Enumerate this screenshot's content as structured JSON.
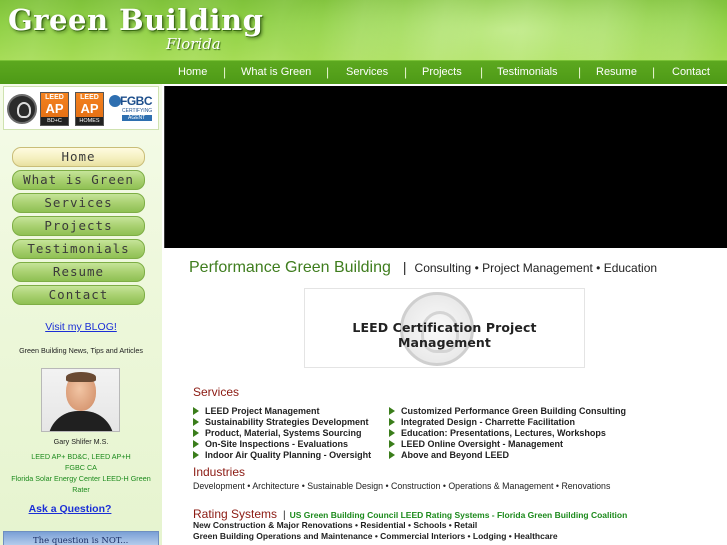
{
  "header": {
    "title": "Green Building",
    "subtitle": "Florida"
  },
  "topnav": {
    "items": [
      "Home",
      "What is Green",
      "Services",
      "Projects",
      "Testimonials",
      "Resume",
      "Contact"
    ],
    "separator": "|"
  },
  "sidebar": {
    "certs": {
      "leed_bdc": {
        "top": "LEED",
        "mid": "AP",
        "bottom": "BD+C"
      },
      "leed_homes": {
        "top": "LEED",
        "mid": "AP",
        "bottom": "HOMES"
      },
      "fgbc": {
        "name": "FGBC",
        "sub": "CERTIFYING",
        "agent": "AGENT"
      }
    },
    "buttons": [
      "Home",
      "What is Green",
      "Services",
      "Projects",
      "Testimonials",
      "Resume",
      "Contact"
    ],
    "blog_link": "Visit my BLOG!",
    "blog_sub": "Green Building News, Tips and Articles",
    "person_name": "Gary Shlifer M.S.",
    "credentials": [
      "LEED AP+ BD&C, LEED AP+H",
      "FGBC CA",
      "Florida Solar Energy Center LEED-H Green Rater"
    ],
    "ask_link": "Ask a Question?",
    "question_box": "The question is NOT..."
  },
  "main": {
    "heading": "Performance Green Building",
    "heading_sep": "|",
    "heading_sub": "Consulting • Project Management • Education",
    "banner_text": "LEED Certification Project Management",
    "services_title": "Services",
    "services_left": [
      "LEED Project Management",
      "Sustainability Strategies Development",
      "Product, Material, Systems Sourcing",
      "On-Site Inspections - Evaluations",
      "Indoor Air Quality Planning - Oversight"
    ],
    "services_right": [
      "Customized Performance Green Building Consulting",
      "Integrated Design - Charrette Facilitation",
      "Education: Presentations, Lectures, Workshops",
      "LEED Online Oversight - Management",
      "Above and Beyond LEED"
    ],
    "industries_title": "Industries",
    "industries_text": "Development • Architecture • Sustainable Design • Construction • Operations & Management • Renovations",
    "rating_title": "Rating Systems",
    "rating_sep": "|",
    "rating_sub": "US Green Building Council LEED Rating Systems - Florida Green Building Coalition",
    "rating_line1": "New Construction & Major Renovations • Residential • Schools • Retail",
    "rating_line2": "Green Building Operations and Maintenance • Commercial Interiors • Lodging • Healthcare"
  },
  "colors": {
    "brand_green": "#4e9a17",
    "heading_green": "#3f7d1e",
    "section_red": "#8b1a12",
    "link_blue": "#1b2fd6"
  },
  "icons": [
    "usgbc-logo",
    "leed-ap-bdc-badge",
    "leed-ap-homes-badge",
    "fgbc-logo",
    "arrow-bullet-icon"
  ]
}
